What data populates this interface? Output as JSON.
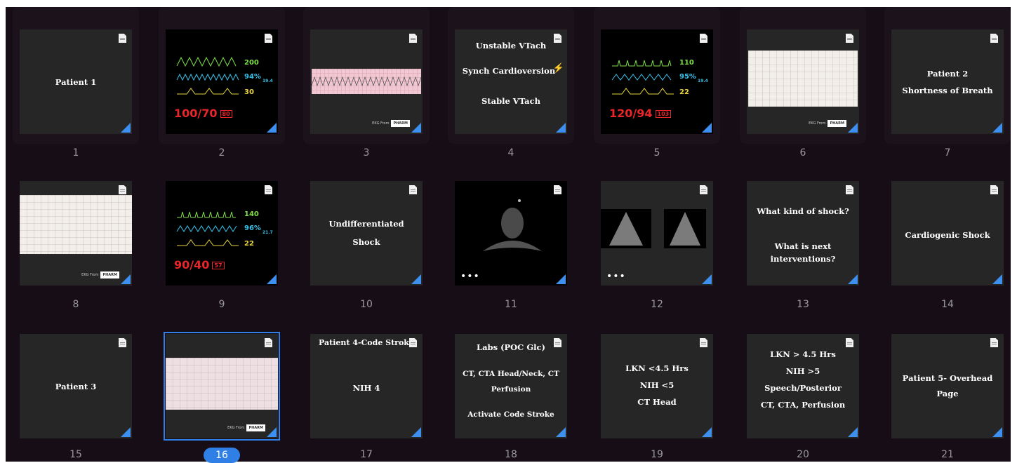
{
  "colors": {
    "background": "#160d17",
    "slide": "#262626",
    "accent": "#2f7fe6",
    "corner_marker": "#3d8ff0",
    "monitor_red": "#e8262a",
    "monitor_green": "#7ee04a",
    "monitor_cyan": "#38c0e8",
    "monitor_yellow": "#e8d43a"
  },
  "selected_slide": 16,
  "slides": [
    {
      "number": "1",
      "lines": [
        "Patient 1"
      ]
    },
    {
      "number": "2",
      "monitor": {
        "hr": "200",
        "spo2": "94%",
        "spo2_small": "19.4",
        "rr": "30",
        "bp": "100/70",
        "map": "80"
      }
    },
    {
      "number": "3",
      "credit": "EKG From",
      "credit_logo": "PHARM"
    },
    {
      "number": "4",
      "lines": [
        "Unstable VTach",
        "Synch Cardioversion",
        "Stable VTach"
      ],
      "icon": "lightning-bolt-icon"
    },
    {
      "number": "5",
      "monitor": {
        "hr": "110",
        "spo2": "95%",
        "spo2_small": "19.4",
        "rr": "22",
        "bp": "120/94",
        "map": "103"
      }
    },
    {
      "number": "6",
      "credit": "EKG From",
      "credit_logo": "PHARM"
    },
    {
      "number": "7",
      "lines": [
        "Patient 2",
        "Shortness of Breath"
      ]
    },
    {
      "number": "8",
      "credit": "EKG From",
      "credit_logo": "PHARM"
    },
    {
      "number": "9",
      "monitor": {
        "hr": "140",
        "spo2": "96%",
        "spo2_small": "21.7",
        "rr": "22",
        "bp": "90/40",
        "map": "57"
      }
    },
    {
      "number": "10",
      "lines": [
        "Undifferentiated",
        "Shock"
      ]
    },
    {
      "number": "11",
      "dots": "•••"
    },
    {
      "number": "12",
      "dots": "•••"
    },
    {
      "number": "13",
      "lines": [
        "What kind of shock?",
        "What is next",
        "interventions?"
      ]
    },
    {
      "number": "14",
      "lines": [
        "Cardiogenic Shock"
      ]
    },
    {
      "number": "15",
      "lines": [
        "Patient 3"
      ]
    },
    {
      "number": "16",
      "credit": "EKG From",
      "credit_logo": "PHARM"
    },
    {
      "number": "17",
      "lines": [
        "Patient 4-Code Stroke",
        "NIH 4"
      ]
    },
    {
      "number": "18",
      "lines": [
        "Labs (POC Glc)",
        "CT, CTA Head/Neck, CT",
        "Perfusion",
        "Activate Code Stroke"
      ]
    },
    {
      "number": "19",
      "lines": [
        "LKN <4.5 Hrs",
        "NIH <5",
        "CT Head"
      ]
    },
    {
      "number": "20",
      "lines": [
        "LKN > 4.5 Hrs",
        "NIH >5",
        "Speech/Posterior",
        "CT, CTA, Perfusion"
      ]
    },
    {
      "number": "21",
      "lines": [
        "Patient 5- Overhead",
        "Page"
      ]
    }
  ]
}
